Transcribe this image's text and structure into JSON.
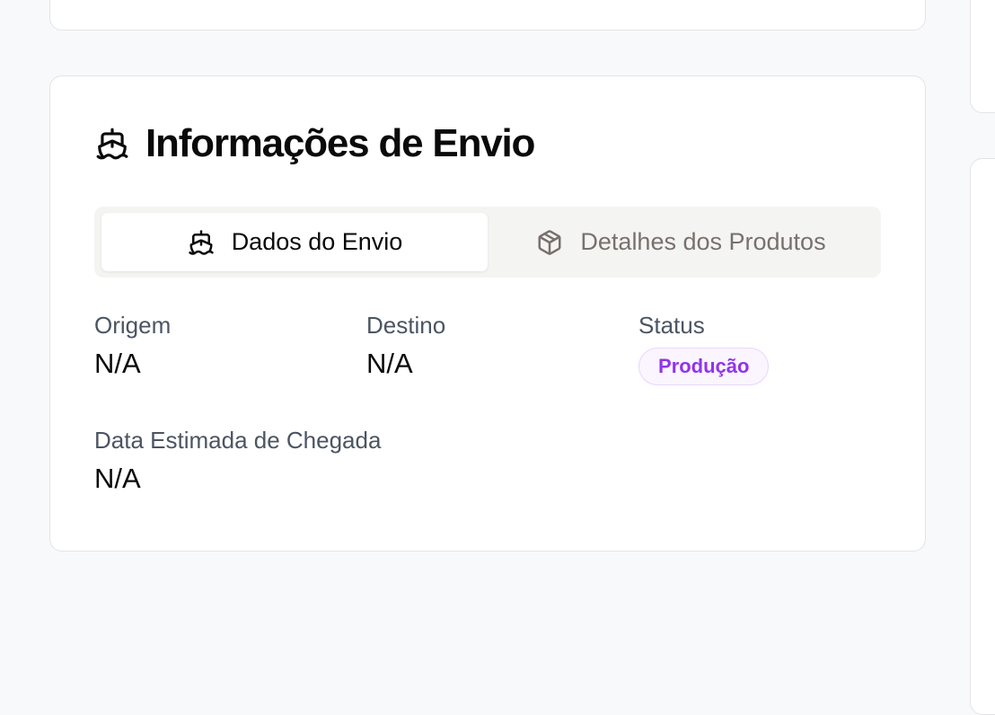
{
  "section": {
    "title": "Informações de Envio",
    "title_icon": "ship-icon"
  },
  "tabs": [
    {
      "label": "Dados do Envio",
      "icon": "ship-icon",
      "active": true
    },
    {
      "label": "Detalhes dos Produtos",
      "icon": "package-icon",
      "active": false
    }
  ],
  "fields": {
    "origem": {
      "label": "Origem",
      "value": "N/A"
    },
    "destino": {
      "label": "Destino",
      "value": "N/A"
    },
    "status": {
      "label": "Status",
      "value": "Produção"
    },
    "eta": {
      "label": "Data Estimada de Chegada",
      "value": "N/A"
    }
  },
  "colors": {
    "badge_text": "#9333ea",
    "badge_bg": "#faf5ff",
    "badge_border": "#e9d5ff"
  }
}
